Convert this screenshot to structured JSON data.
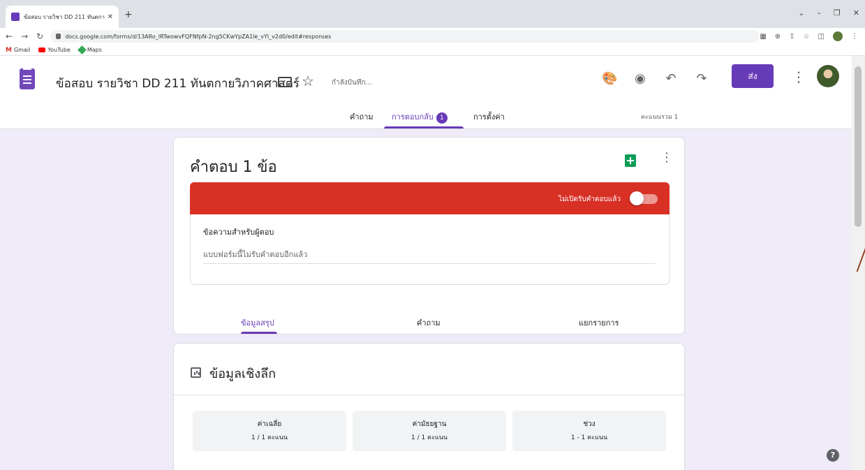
{
  "browser": {
    "tab_title": "ข้อสอบ รายวิชา DD 211 ทันตกายวิภ",
    "url": "docs.google.com/forms/d/13ARo_lRTwowvFQFNfpN-2ng5CKwYpZA1le_vYl_v2d0/edit#responses",
    "bookmarks": [
      "Gmail",
      "YouTube",
      "Maps"
    ]
  },
  "header": {
    "form_title": "ข้อสอบ รายวิชา DD 211 ทันตกายวิภาคศาสตร์",
    "saving_status": "กำลังบันทึก...",
    "send_label": "ส่ง",
    "tabs": {
      "questions": "คำถาม",
      "responses": "การตอบกลับ",
      "responses_count": "1",
      "settings": "การตั้งค่า"
    },
    "total_points": "คะแนนรวม 1"
  },
  "responses_card": {
    "title": "คำตอบ 1 ข้อ",
    "not_accepting": "ไม่เปิดรับคำตอบแล้ว",
    "message_label": "ข้อความสำหรับผู้ตอบ",
    "message_text": "แบบฟอร์มนี้ไม่รับคำตอบอีกแล้ว",
    "subtabs": {
      "summary": "ข้อมูลสรุป",
      "question": "คำถาม",
      "individual": "แยกรายการ"
    }
  },
  "insights": {
    "title": "ข้อมูลเชิงลึก",
    "stats": [
      {
        "label": "ค่าเฉลี่ย",
        "value": "1 / 1 คะแนน"
      },
      {
        "label": "ค่ามัธยฐาน",
        "value": "1 / 1 คะแนน"
      },
      {
        "label": "ช่วง",
        "value": "1 - 1 คะแนน"
      }
    ]
  },
  "colors": {
    "accent": "#673ab7",
    "banner": "#d93025",
    "background": "#f0ebf8"
  }
}
